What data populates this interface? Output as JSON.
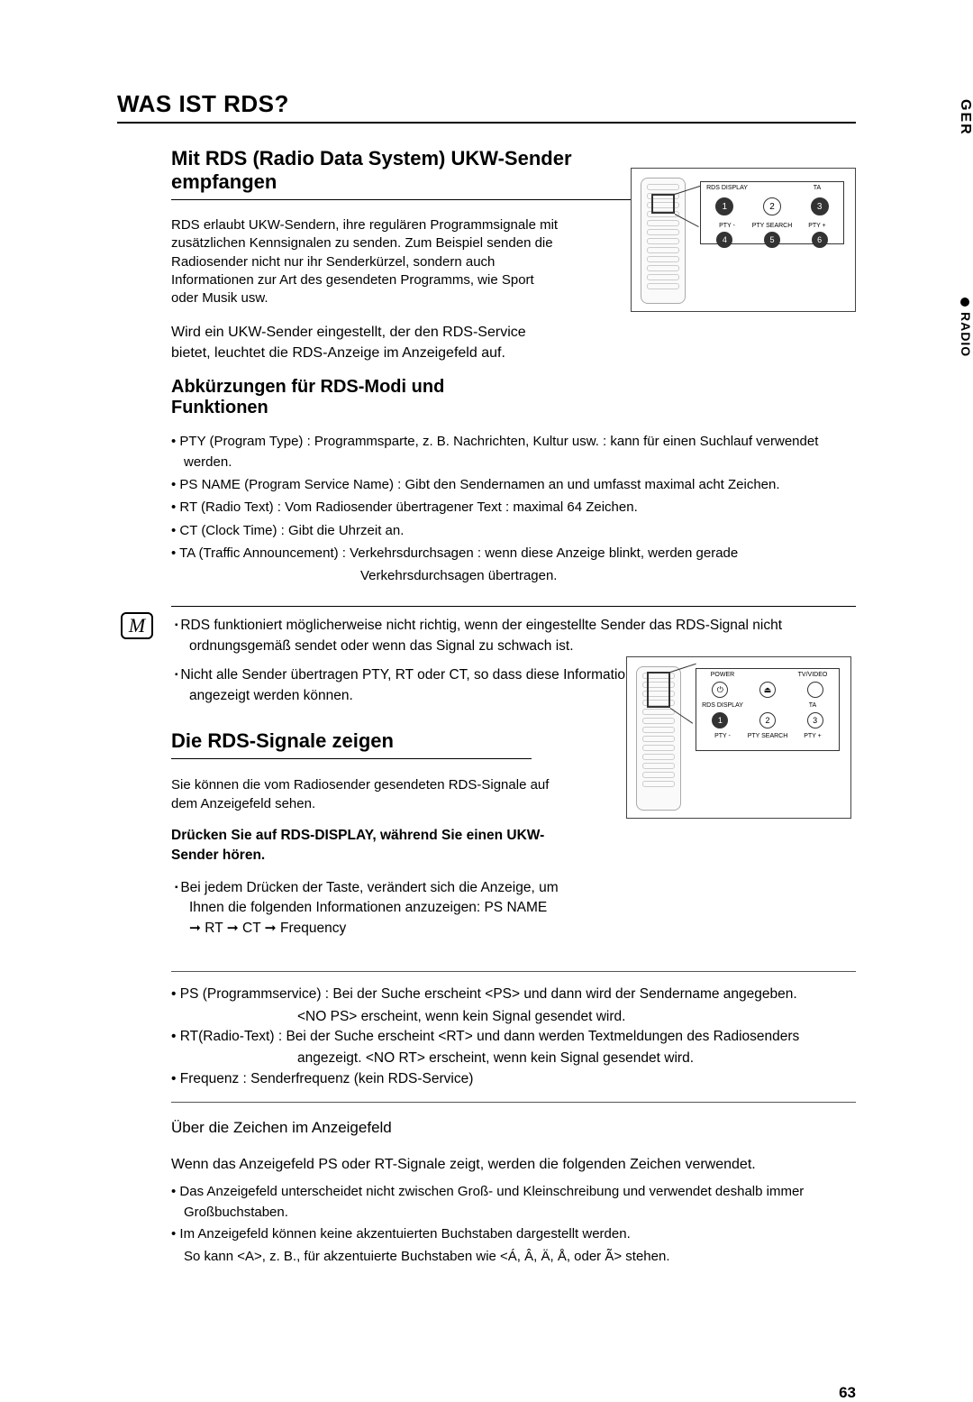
{
  "side": {
    "lang": "GER",
    "section": "RADIO"
  },
  "page_number": "63",
  "h1": "WAS IST RDS?",
  "h2a": "Mit RDS (Radio Data System) UKW-Sender empfangen",
  "intro": "RDS erlaubt UKW-Sendern, ihre regulären Programmsignale mit zusätzlichen Kennsignalen zu senden. Zum Beispiel senden die Radiosender nicht nur ihr Senderkürzel, sondern auch Informationen zur Art des gesendeten Programms, wie Sport oder Musik usw.",
  "para": "Wird ein UKW-Sender eingestellt, der den RDS-Service bietet, leuchtet die RDS-Anzeige im Anzeigefeld auf.",
  "h3": "Abkürzungen für RDS-Modi und Funktionen",
  "defs": {
    "pty": "PTY (Program Type) : Programmsparte, z. B. Nachrichten, Kultur usw. : kann für einen Suchlauf verwendet werden.",
    "ps": "PS NAME (Program Service Name) : Gibt den Sendernamen an und umfasst maximal acht Zeichen.",
    "rt": "RT (Radio Text) : Vom Radiosender übertragener Text : maximal 64 Zeichen.",
    "ct": "CT (Clock Time) : Gibt die Uhrzeit an.",
    "ta": "TA (Traffic Announcement) : Verkehrsdurchsagen : wenn diese Anzeige blinkt, werden gerade",
    "ta_cont": "Verkehrsdurchsagen übertragen."
  },
  "note_icon": "M",
  "notes": {
    "n1": "RDS funktioniert möglicherweise nicht richtig, wenn der eingestellte Sender das RDS-Signal nicht ordnungsgemäß sendet oder wenn das Signal zu schwach ist.",
    "n2": "Nicht alle Sender übertragen PTY, RT oder CT, so dass diese Informationen nicht bei allen RDS-Sendern angezeigt werden können."
  },
  "h2b": "Die RDS-Signale zeigen",
  "sig_intro": "Sie können die vom Radiosender gesendeten RDS-Signale auf dem Anzeigefeld sehen.",
  "bold_instr": "Drücken Sie auf RDS-DISPLAY, während Sie einen UKW-Sender hören.",
  "sq_item": "Bei jedem Drücken der Taste, verändert sich die Anzeige, um Ihnen die folgenden Informationen anzuzeigen: PS NAME ➞ RT ➞ CT ➞ Frequency",
  "second": {
    "ps": "PS (Programmservice) : Bei der Suche erscheint <PS> und dann wird der Sendername angegeben.",
    "ps_cont": "<NO PS> erscheint, wenn kein Signal gesendet wird.",
    "rt": "RT(Radio-Text) : Bei der Suche erscheint <RT> und dann werden Textmeldungen des Radiosenders",
    "rt_cont": "angezeigt. <NO RT> erscheint, wenn kein Signal gesendet wird.",
    "freq": "Frequenz : Senderfrequenz (kein RDS-Service)"
  },
  "sub_title": "Über die Zeichen im Anzeigefeld",
  "sub_intro": "Wenn das Anzeigefeld PS oder RT-Signale zeigt, werden die folgenden Zeichen verwendet.",
  "chars": {
    "c1": "Das Anzeigefeld unterscheidet nicht zwischen Groß- und Kleinschreibung und verwendet deshalb immer Großbuchstaben.",
    "c2": "Im Anzeigefeld können keine akzentuierten Buchstaben dargestellt werden.",
    "c2_cont": "So kann <A>, z. B., für akzentuierte Buchstaben wie <Á, Â, Ä, Å,  oder Ã> stehen."
  },
  "remote": {
    "top_labels": {
      "l1": "RDS DISPLAY",
      "l2": "TA",
      "b1": "PTY -",
      "b2": "PTY SEARCH",
      "b3": "PTY +"
    },
    "nums": {
      "n1": "1",
      "n2": "2",
      "n3": "3",
      "n4": "4",
      "n5": "5",
      "n6": "6"
    },
    "mid_labels": {
      "p": "POWER",
      "tv": "TV/VIDEO",
      "r": "RDS DISPLAY",
      "t": "TA",
      "b1": "PTY -",
      "b2": "PTY SEARCH",
      "b3": "PTY +"
    }
  }
}
